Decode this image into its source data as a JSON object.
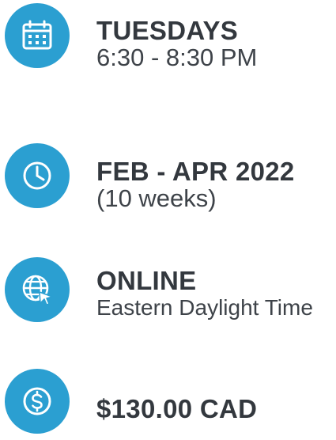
{
  "colors": {
    "icon_circle": "#2b9fd1",
    "icon_glyph": "#ffffff",
    "text": "#33383e"
  },
  "items": [
    {
      "icon": "calendar-icon",
      "title": "TUESDAYS",
      "subtitle": "6:30 - 8:30 PM"
    },
    {
      "icon": "clock-icon",
      "title": "FEB - APR 2022",
      "subtitle": "(10 weeks)"
    },
    {
      "icon": "globe-cursor-icon",
      "title": "ONLINE",
      "subtitle": "Eastern Daylight Time"
    },
    {
      "icon": "dollar-coin-icon",
      "title": "$130.00 CAD",
      "subtitle": ""
    }
  ]
}
